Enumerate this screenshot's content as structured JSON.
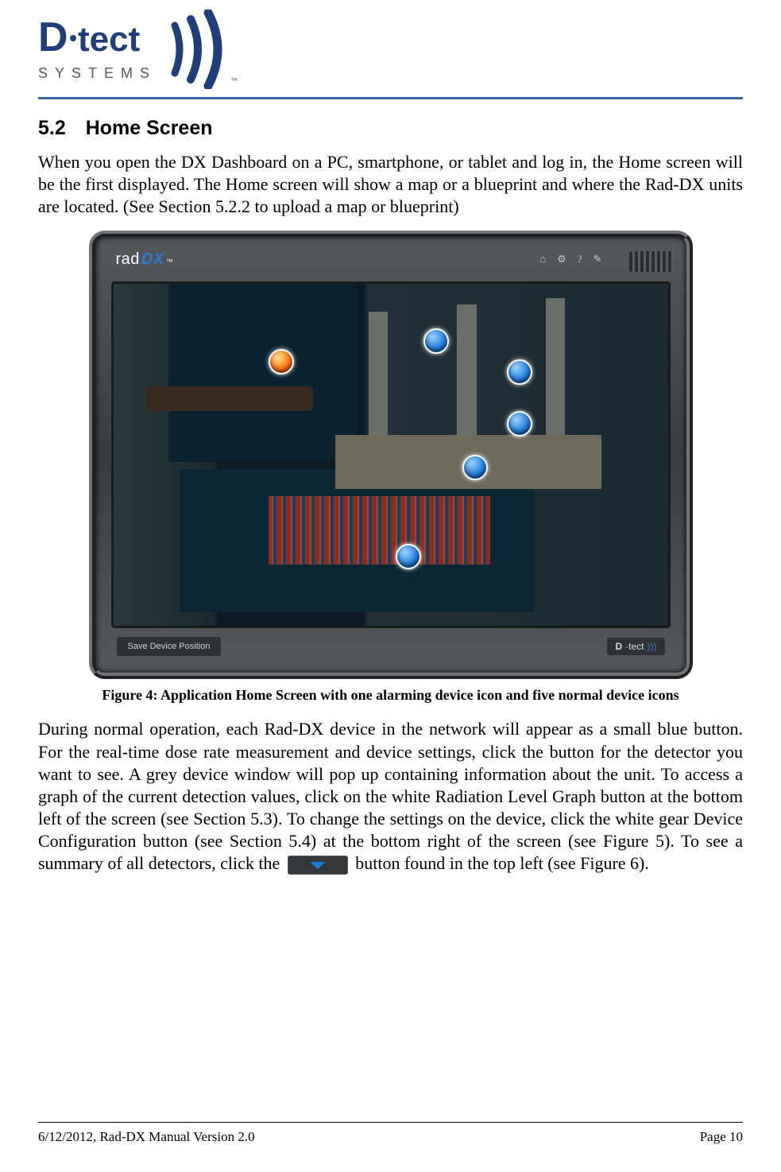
{
  "header": {
    "logo_main": "D·tect",
    "logo_sub": "S Y S T E M S",
    "tm": "™"
  },
  "section": {
    "number": "5.2",
    "title": "Home Screen"
  },
  "para1": "When you open the DX Dashboard on a PC, smartphone, or tablet and log in, the Home screen will be the first displayed. The Home screen will show a map or a blueprint and where the Rad-DX units are located. (See Section 5.2.2 to upload a map or blueprint)",
  "app": {
    "brand_rad": "rad",
    "brand_dx": "DX",
    "brand_tm": "™",
    "icons": {
      "home": "⌂",
      "gear": "⚙",
      "help": "?",
      "edit": "✎"
    },
    "save_btn": "Save Device Position",
    "mini_logo": "D·tect ))) "
  },
  "figure_caption": "Figure 4: Application Home Screen with one alarming device icon and five normal device icons",
  "para2a": "During normal operation, each Rad-DX device in the network will appear as a small blue button. For the real-time dose rate measurement and device settings, click the button for the detector you want to see. A grey device window will pop up containing information about the unit. To access a graph of the current detection values, click on the white Radiation Level Graph button at the bottom left of the screen (see Section 5.3). To change the settings on the device, click the white gear Device Configuration button (see Section 5.4) at the bottom right of the screen (see Figure 5).  To see a summary of all detectors, click the ",
  "para2b": " button found in the top left (see Figure 6).",
  "footer": {
    "left": "6/12/2012, Rad-DX Manual Version 2.0",
    "right": "Page 10"
  }
}
